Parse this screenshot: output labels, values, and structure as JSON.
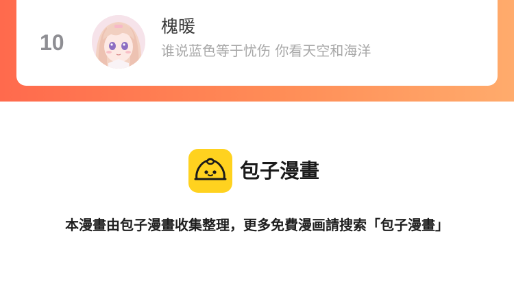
{
  "rank_entry": {
    "rank": "10",
    "name": "槐暖",
    "bio": "谁说蓝色等于忧伤 你看天空和海洋"
  },
  "brand": {
    "name": "包子漫畫",
    "logo_icon": "steamed-bun-icon",
    "logo_color": "#ffd21f"
  },
  "notice": "本漫畫由包子漫畫收集整理，更多免費漫画請搜索「包子漫畫」",
  "colors": {
    "header_gradient_start": "#ff6a4d",
    "header_gradient_end": "#ffab6c",
    "rank_text": "#8e8e93",
    "bio_text": "#a8a8a8"
  }
}
